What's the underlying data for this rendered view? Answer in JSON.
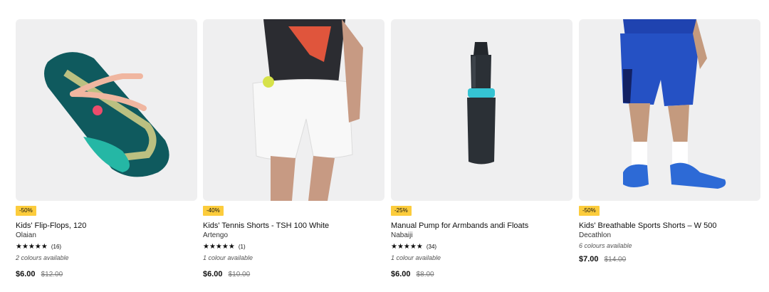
{
  "products": [
    {
      "discount": "-50%",
      "name": "Kids' Flip-Flops, 120",
      "brand": "Olaian",
      "stars": "★★★★★",
      "rating": 4.5,
      "reviews": "(16)",
      "availability": "2 colours available",
      "price": "$6.00",
      "original_price": "$12.00",
      "image": "flip-flop"
    },
    {
      "discount": "-40%",
      "name": "Kids' Tennis Shorts - TSH 100 White",
      "brand": "Artengo",
      "stars": "★★★★★",
      "rating": 5,
      "reviews": "(1)",
      "availability": "1 colour available",
      "price": "$6.00",
      "original_price": "$10.00",
      "image": "tennis-shorts"
    },
    {
      "discount": "-25%",
      "name": "Manual Pump for Armbands andi Floats",
      "brand": "Nabaiji",
      "stars": "★★★★★",
      "rating": 4.5,
      "reviews": "(34)",
      "availability": "1 colour available",
      "price": "$6.00",
      "original_price": "$8.00",
      "image": "pump"
    },
    {
      "discount": "-50%",
      "name": "Kids' Breathable Sports Shorts – W 500",
      "brand": "Decathlon",
      "availability": "6 colours available",
      "price": "$7.00",
      "original_price": "$14.00",
      "image": "sports-shorts"
    }
  ],
  "colors": {
    "badge": "#fccc3c",
    "image_bg": "#efeff0",
    "text": "#101010"
  }
}
